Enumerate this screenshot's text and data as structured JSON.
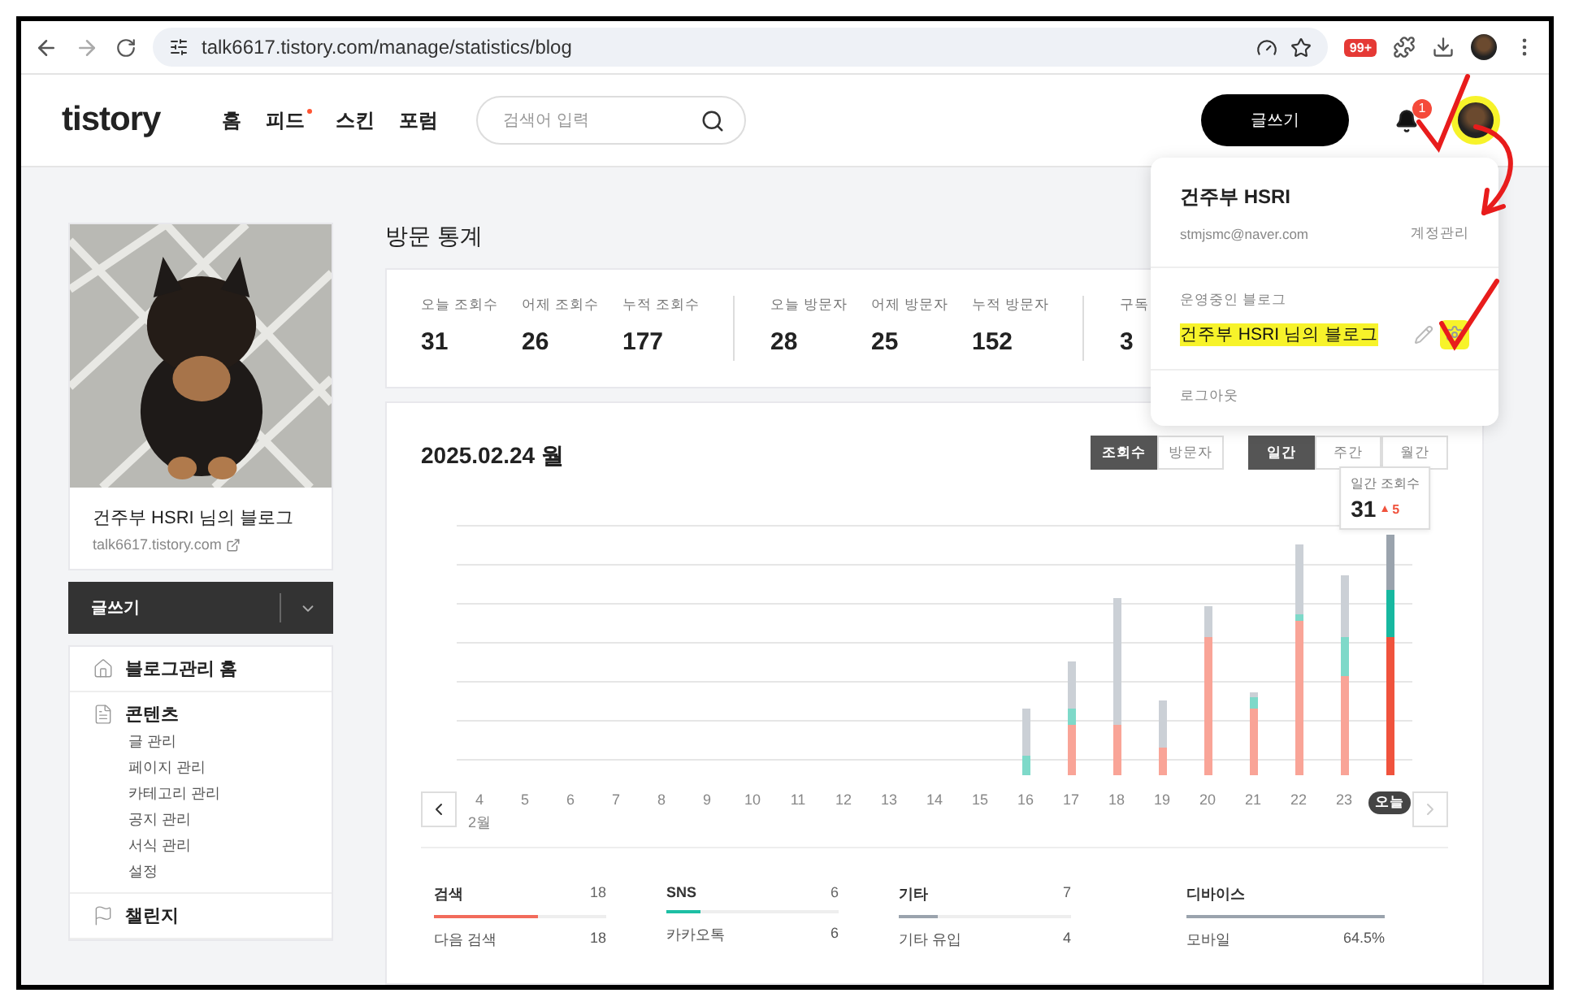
{
  "browser": {
    "url": "talk6617.tistory.com/manage/statistics/blog",
    "extension_badge": "99+"
  },
  "header": {
    "logo": "tistory",
    "nav": [
      {
        "label": "홈",
        "new": false
      },
      {
        "label": "피드",
        "new": true
      },
      {
        "label": "스킨",
        "new": false
      },
      {
        "label": "포럼",
        "new": false
      }
    ],
    "search": {
      "placeholder": "검색어 입력"
    },
    "write_button": "글쓰기",
    "notification_count": "1",
    "avatar_highlighted": true
  },
  "profile_menu": {
    "name": "건주부 HSRI",
    "email": "stmjsmc@naver.com",
    "account_link": "계정관리",
    "blog_section": "운영중인 블로그",
    "blog_name": "건주부 HSRI 님의 블로그",
    "blog_name_highlighted": true,
    "settings_highlighted": true,
    "logout": "로그아웃"
  },
  "sidebar": {
    "blog_title": "건주부 HSRI 님의 블로그",
    "blog_url": "talk6617.tistory.com",
    "write_button": "글쓰기",
    "menu": [
      {
        "label": "블로그관리 홈"
      },
      {
        "label": "콘텐츠",
        "children": [
          {
            "label": "글 관리"
          },
          {
            "label": "페이지 관리"
          },
          {
            "label": "카테고리 관리"
          },
          {
            "label": "공지 관리"
          },
          {
            "label": "서식 관리"
          },
          {
            "label": "설정"
          }
        ]
      },
      {
        "label": "챌린지"
      }
    ]
  },
  "page_title": "방문 통계",
  "stats": [
    [
      {
        "label": "오늘 조회수",
        "value": "31"
      },
      {
        "label": "어제 조회수",
        "value": "26"
      },
      {
        "label": "누적 조회수",
        "value": "177"
      }
    ],
    [
      {
        "label": "오늘 방문자",
        "value": "28"
      },
      {
        "label": "어제 방문자",
        "value": "25"
      },
      {
        "label": "누적 방문자",
        "value": "152"
      }
    ],
    [
      {
        "label": "구독",
        "value": "3"
      }
    ]
  ],
  "chart": {
    "date": "2025.02.24 월",
    "metric_tabs": [
      {
        "label": "조회수",
        "selected": true
      },
      {
        "label": "방문자",
        "selected": false
      }
    ],
    "period_tabs": [
      {
        "label": "일간",
        "selected": true
      },
      {
        "label": "주간",
        "selected": false
      },
      {
        "label": "월간",
        "selected": false
      }
    ],
    "days": [
      {
        "label": "4",
        "month": "2월",
        "today": false
      },
      {
        "label": "5",
        "today": false
      },
      {
        "label": "6",
        "today": false
      },
      {
        "label": "7",
        "today": false
      },
      {
        "label": "8",
        "today": false
      },
      {
        "label": "9",
        "today": false
      },
      {
        "label": "10",
        "today": false
      },
      {
        "label": "11",
        "today": false
      },
      {
        "label": "12",
        "today": false
      },
      {
        "label": "13",
        "today": false
      },
      {
        "label": "14",
        "today": false
      },
      {
        "label": "15",
        "today": false
      },
      {
        "label": "16",
        "today": false
      },
      {
        "label": "17",
        "today": false
      },
      {
        "label": "18",
        "today": false
      },
      {
        "label": "19",
        "today": false
      },
      {
        "label": "20",
        "today": false
      },
      {
        "label": "21",
        "today": false
      },
      {
        "label": "22",
        "today": false
      },
      {
        "label": "23",
        "today": false
      },
      {
        "label": "오늘",
        "today": true
      }
    ],
    "tooltip": {
      "label": "일간 조회수",
      "value": "31",
      "change": "5"
    }
  },
  "sources": [
    {
      "title": "검색",
      "total": "18",
      "color": "#f26b5b",
      "level": 0.6,
      "rows": [
        {
          "label": "다음 검색",
          "value": "18"
        }
      ]
    },
    {
      "title": "SNS",
      "total": "6",
      "color": "#1dbfa4",
      "level": 0.2,
      "rows": [
        {
          "label": "카카오톡",
          "value": "6"
        }
      ]
    },
    {
      "title": "기타",
      "total": "7",
      "color": "#9aa3ad",
      "level": 0.23,
      "rows": [
        {
          "label": "기타 유입",
          "value": "4"
        }
      ]
    },
    {
      "title": "디바이스",
      "color": "#9aa3ad",
      "level": 1,
      "rows": [
        {
          "label": "모바일",
          "value": "64.5%"
        }
      ]
    }
  ]
}
